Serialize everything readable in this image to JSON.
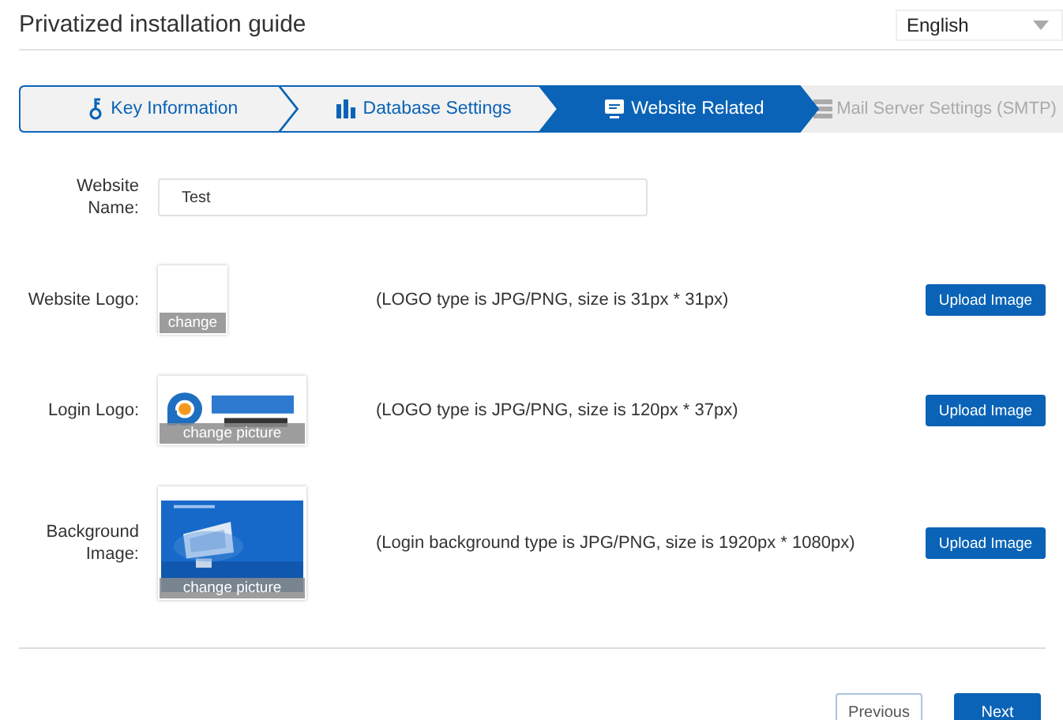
{
  "header": {
    "title": "Privatized installation guide",
    "language": "English"
  },
  "steps": [
    {
      "label": "Key Information",
      "kind": "key",
      "completed": true,
      "selected": false
    },
    {
      "label": "Database Settings",
      "kind": "database",
      "completed": true,
      "selected": false
    },
    {
      "label": "Website Related",
      "kind": "monitor",
      "completed": false,
      "selected": true
    },
    {
      "label": "Mail Server Settings (SMTP)",
      "kind": "server",
      "completed": false,
      "selected": false
    }
  ],
  "website_name": {
    "label": "Website Name:",
    "value": "Test"
  },
  "images": [
    {
      "label": "Website Logo:",
      "kind": "empty",
      "overlay": "change",
      "hint": "(LOGO type is JPG/PNG, size is 31px * 31px)",
      "button": "Upload Image"
    },
    {
      "label": "Login Logo:",
      "kind": "logo",
      "overlay": "change picture",
      "hint": "(LOGO type is JPG/PNG, size is 120px * 37px)",
      "button": "Upload Image"
    },
    {
      "label": "Background Image:",
      "kind": "picture",
      "overlay": "change picture",
      "hint": "(Login background type is JPG/PNG, size is 1920px * 1080px)",
      "button": "Upload Image"
    }
  ],
  "footer": {
    "previous": "Previous",
    "next": "Next"
  }
}
